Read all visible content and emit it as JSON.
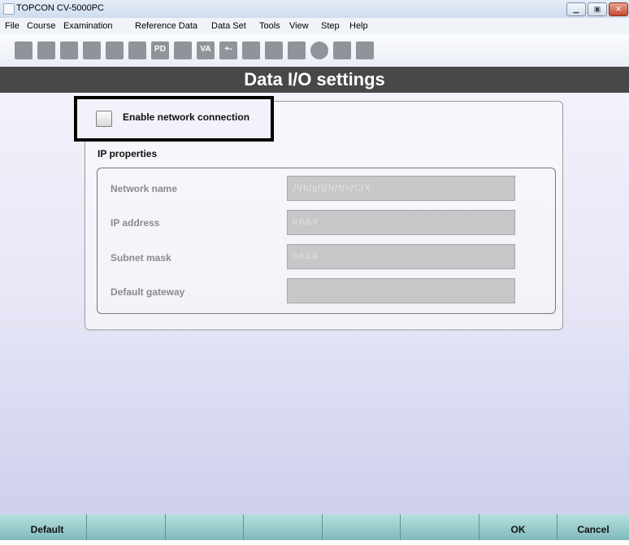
{
  "window": {
    "title": "TOPCON CV-5000PC"
  },
  "menubar": {
    "items": [
      "File",
      "Course",
      "Examination",
      "Reference Data",
      "Data Set",
      "Tools",
      "View",
      "Step",
      "Help"
    ]
  },
  "toolbar": {
    "icons": [
      "printer-icon",
      "patient-icon",
      "examination-icon",
      "examination-2-icon",
      "keyboard-icon",
      "folder-icon",
      "pd-icon",
      "chart-icon",
      "va-icon",
      "addition-icon",
      "display-icon",
      "display-2-icon",
      "book-icon",
      "circle-icon",
      "user-icon",
      "wrench-icon"
    ],
    "pd_label": "PD",
    "va_label": "VA",
    "add_label": "+-"
  },
  "header": {
    "title": "Data I/O settings"
  },
  "settings": {
    "enable_network_label": "Enable network connection",
    "ip_properties_label": "IP properties",
    "fields": [
      {
        "label": "Network name",
        "value": "ƒlƒbƒgƒ[ƒNƒfƒoƒCƒX"
      },
      {
        "label": "IP address",
        "value": "0.0.0.0"
      },
      {
        "label": "Subnet mask",
        "value": "0.0.0.0"
      },
      {
        "label": "Default gateway",
        "value": ""
      }
    ]
  },
  "function_keys": [
    "Default",
    "",
    "",
    "",
    "",
    "",
    "OK",
    "Cancel"
  ],
  "colors": {
    "header": "#484848",
    "content_top": "#f2f2fb",
    "content_bottom": "#cfcfee",
    "function_bar": "#9ccfcf"
  }
}
